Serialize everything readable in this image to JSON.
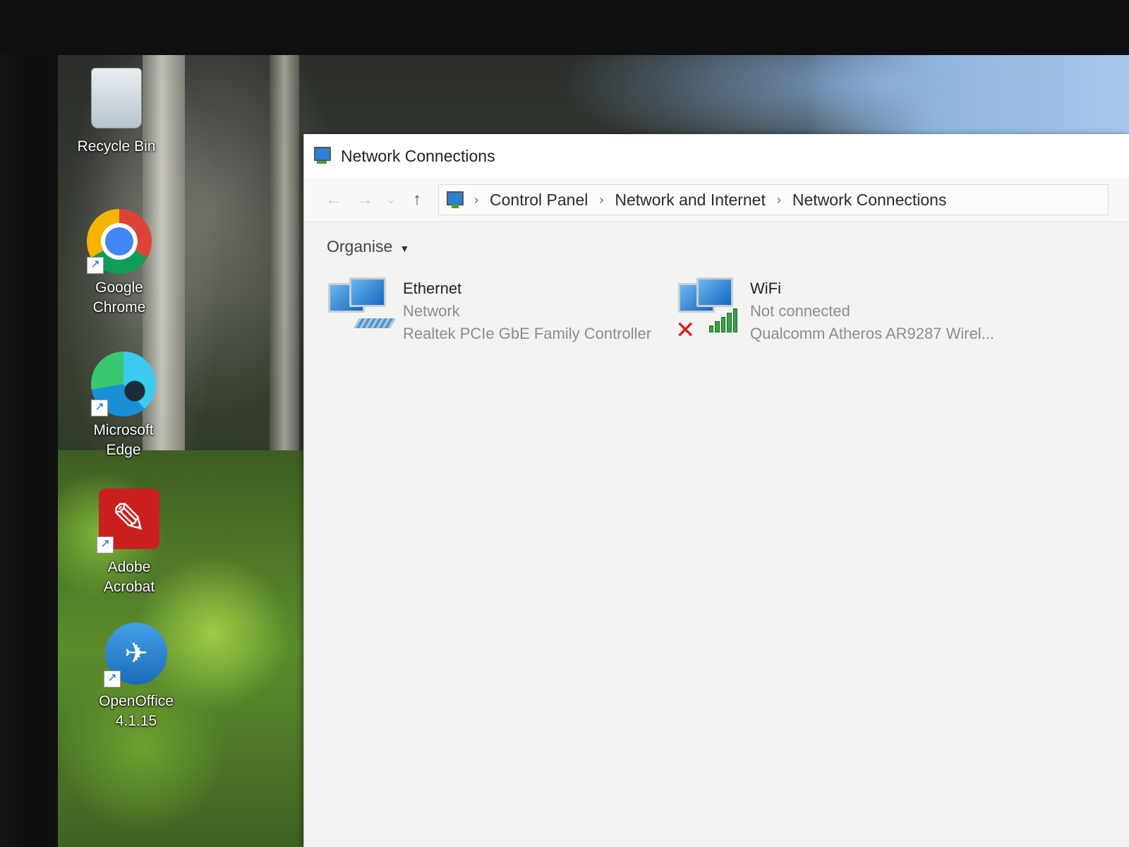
{
  "desktop": {
    "icons": [
      {
        "label": "Recycle Bin",
        "icon": "recycle-bin-icon"
      },
      {
        "label": "Google Chrome",
        "icon": "chrome-icon"
      },
      {
        "label": "Microsoft Edge",
        "icon": "edge-icon"
      },
      {
        "label": "Adobe Acrobat",
        "icon": "acrobat-icon"
      },
      {
        "label": "OpenOffice 4.1.15",
        "icon": "openoffice-icon"
      }
    ]
  },
  "window": {
    "title": "Network Connections",
    "breadcrumb": [
      "Control Panel",
      "Network and Internet",
      "Network Connections"
    ],
    "toolbar": {
      "organise_label": "Organise"
    },
    "connections": [
      {
        "name": "Ethernet",
        "status": "Network",
        "adapter": "Realtek PCIe GbE Family Controller",
        "icon": "ethernet-adapter-icon"
      },
      {
        "name": "WiFi",
        "status": "Not connected",
        "adapter": "Qualcomm Atheros AR9287 Wirel...",
        "icon": "wifi-adapter-icon"
      }
    ]
  },
  "colors": {
    "disconnected": "#d81b1b",
    "signal": "#3aa142"
  }
}
